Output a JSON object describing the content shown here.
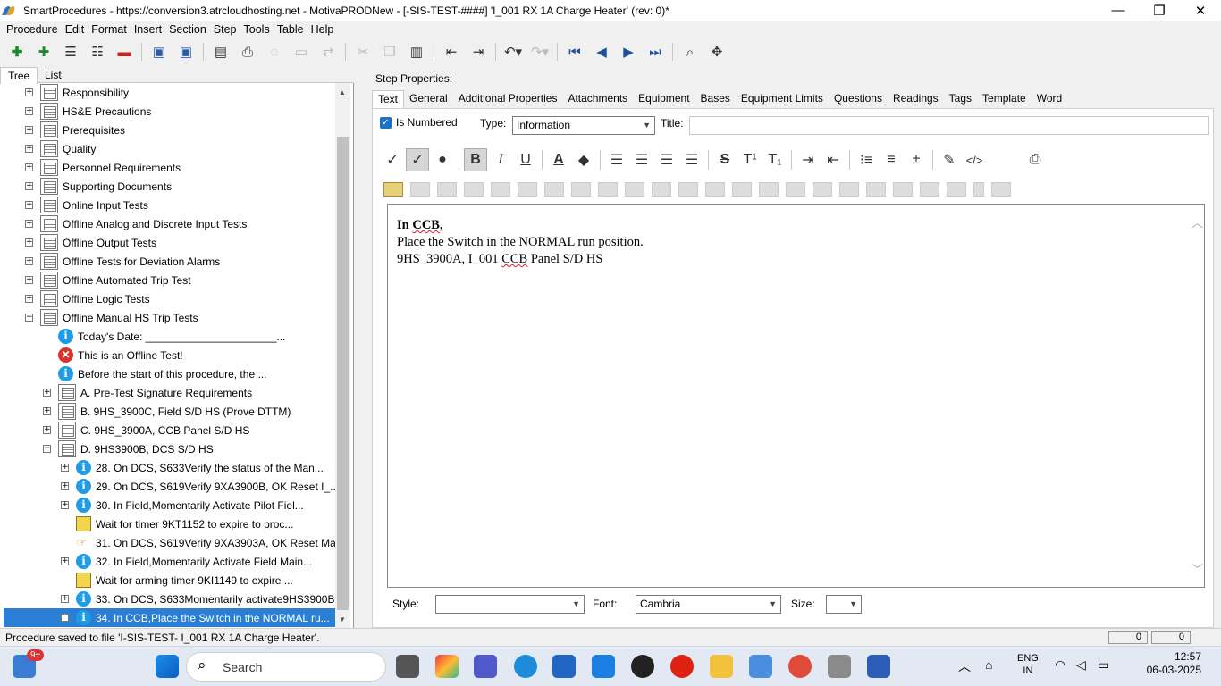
{
  "window": {
    "title": "SmartProcedures - https://conversion3.atrcloudhosting.net - MotivaPRODNew - [-SIS-TEST-####] 'I_001 RX 1A Charge Heater' (rev: 0)*",
    "min_label": "—",
    "max_label": "❐",
    "close_label": "✕"
  },
  "menu": [
    "Procedure",
    "Edit",
    "Format",
    "Insert",
    "Section",
    "Step",
    "Tools",
    "Table",
    "Help"
  ],
  "left_tabs": {
    "tree": "Tree",
    "list": "List"
  },
  "tree": [
    {
      "label": "Responsibility",
      "icon": "page-icon"
    },
    {
      "label": "HS&E Precautions",
      "icon": "page-icon"
    },
    {
      "label": "Prerequisites",
      "icon": "page-icon"
    },
    {
      "label": "Quality",
      "icon": "page-icon"
    },
    {
      "label": "Personnel Requirements",
      "icon": "page-icon"
    },
    {
      "label": "Supporting Documents",
      "icon": "page-icon"
    },
    {
      "label": "Online Input Tests",
      "icon": "page-icon"
    },
    {
      "label": "Offline Analog and Discrete Input Tests",
      "icon": "page-icon"
    },
    {
      "label": "Offline Output Tests",
      "icon": "page-icon"
    },
    {
      "label": "Offline Tests for Deviation Alarms",
      "icon": "page-icon"
    },
    {
      "label": "Offline Automated Trip Test",
      "icon": "page-icon"
    },
    {
      "label": "Offline Logic Tests",
      "icon": "page-icon"
    },
    {
      "label": "Offline Manual HS Trip Tests",
      "icon": "page-icon"
    },
    {
      "label": "Today's Date: ______________________...",
      "icon": "info-icon"
    },
    {
      "label": "This is an Offline Test!",
      "icon": "error-icon"
    },
    {
      "label": "Before the start of this procedure, the ...",
      "icon": "info-icon"
    },
    {
      "label": "A. Pre-Test Signature Requirements",
      "icon": "page-icon"
    },
    {
      "label": "B. 9HS_3900C, Field S/D HS (Prove DTTM)",
      "icon": "page-icon"
    },
    {
      "label": "C. 9HS_3900A, CCB Panel S/D HS",
      "icon": "page-icon"
    },
    {
      "label": "D. 9HS3900B, DCS S/D HS",
      "icon": "page-icon"
    },
    {
      "label": "28. On DCS, S633Verify the status of the Man...",
      "icon": "info-icon"
    },
    {
      "label": "29. On DCS, S619Verify 9XA3900B, OK Reset I_...",
      "icon": "info-icon"
    },
    {
      "label": "30. In Field,Momentarily Activate Pilot Fiel...",
      "icon": "info-icon"
    },
    {
      "label": "Wait for timer 9KT1152 to expire to proc...",
      "icon": "timer-icon"
    },
    {
      "label": "31. On DCS, S619Verify 9XA3903A, OK Reset Ma...",
      "icon": "hand-icon"
    },
    {
      "label": "32. In Field,Momentarily Activate Field Main...",
      "icon": "info-icon"
    },
    {
      "label": "Wait for arming timer 9KI1149 to expire ...",
      "icon": "timer-icon"
    },
    {
      "label": "33. On DCS, S633Momentarily activate9HS3900B...",
      "icon": "info-icon"
    },
    {
      "label": "34. In CCB,Place the Switch in the NORMAL ru...",
      "icon": "info-icon"
    }
  ],
  "step_properties": {
    "heading": "Step Properties:",
    "tabs": [
      "Text",
      "General",
      "Additional Properties",
      "Attachments",
      "Equipment",
      "Bases",
      "Equipment Limits",
      "Questions",
      "Readings",
      "Tags",
      "Template",
      "Word"
    ],
    "is_numbered_label": "Is Numbered",
    "type_label": "Type:",
    "type_value": "Information",
    "title_label": "Title:",
    "title_value": ""
  },
  "editor": {
    "line1_bold": "In ",
    "line1_sq": "CCB",
    "line1_end": ",",
    "line2": "Place the Switch in the NORMAL run position.",
    "line3_a": "9HS_3900A, I_001 ",
    "line3_sq": "CCB",
    "line3_b": " Panel S/D HS"
  },
  "format_bar": {
    "style_label": "Style:",
    "style_value": "",
    "font_label": "Font:",
    "font_value": "Cambria",
    "size_label": "Size:",
    "size_value": ""
  },
  "status": {
    "message": "Procedure saved to file 'I-SIS-TEST-     I_001 RX 1A Charge Heater'.",
    "field1": "0",
    "field2": "0"
  },
  "taskbar": {
    "search_placeholder": "Search",
    "badge": "9+",
    "lang1": "ENG",
    "lang2": "IN",
    "time": "12:57",
    "date": "06-03-2025"
  }
}
